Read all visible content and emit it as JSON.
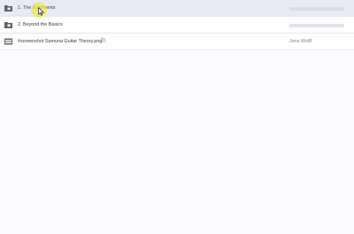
{
  "rows": [
    {
      "name": "1. The Rudiments",
      "icon": "folder-icon",
      "owner": "",
      "selected": true
    },
    {
      "name": "2. Beyond the Basics",
      "icon": "folder-icon",
      "owner": "",
      "selected": false
    },
    {
      "name": "#screenshot Samurai Guitar Theory.png",
      "icon": "image-file-icon",
      "shared_icon": "shared-people-icon",
      "owner": "Jens Wolff"
    }
  ],
  "colors": {
    "selected_row": "#e8eaf6",
    "highlight": "#ece85a",
    "text": "#3c4043",
    "muted_text": "#80868b"
  }
}
